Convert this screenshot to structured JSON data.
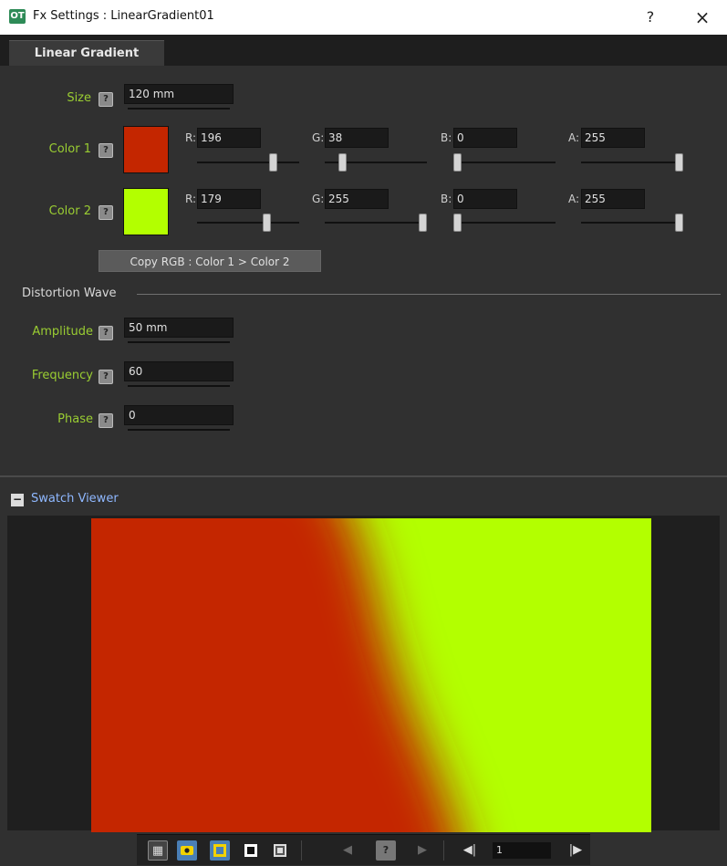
{
  "window": {
    "app_icon": "OT",
    "title": "Fx Settings : LinearGradient01",
    "help_label": "?",
    "close_label": "×"
  },
  "tabs": [
    {
      "label": "Linear Gradient",
      "active": true
    }
  ],
  "params": {
    "size": {
      "label": "Size",
      "value": "120 mm"
    },
    "color1": {
      "label": "Color 1",
      "hex": "#c42600",
      "r": {
        "label": "R:",
        "value": "196",
        "fraction": 0.769
      },
      "g": {
        "label": "G:",
        "value": "38",
        "fraction": 0.149
      },
      "b": {
        "label": "B:",
        "value": "0",
        "fraction": 0.0
      },
      "a": {
        "label": "A:",
        "value": "255",
        "fraction": 1.0
      }
    },
    "color2": {
      "label": "Color 2",
      "hex": "#b3ff00",
      "r": {
        "label": "R:",
        "value": "179",
        "fraction": 0.702
      },
      "g": {
        "label": "G:",
        "value": "255",
        "fraction": 1.0
      },
      "b": {
        "label": "B:",
        "value": "0",
        "fraction": 0.0
      },
      "a": {
        "label": "A:",
        "value": "255",
        "fraction": 1.0
      }
    },
    "copy_button": "Copy RGB : Color 1 > Color 2",
    "distortion_group": "Distortion Wave",
    "amplitude": {
      "label": "Amplitude",
      "value": "50 mm"
    },
    "frequency": {
      "label": "Frequency",
      "value": "60"
    },
    "phase": {
      "label": "Phase",
      "value": "0"
    },
    "key_icon": "?"
  },
  "swatch_viewer": {
    "collapse_label": "−",
    "title": "Swatch Viewer",
    "frame_value": "1",
    "toolbar_icons": [
      "checker-icon",
      "preview-eye-icon",
      "camera-stand-icon",
      "black-bg-icon",
      "white-bg-icon",
      "prev-key-icon",
      "key-icon",
      "next-key-icon",
      "prev-frame-icon",
      "next-frame-icon"
    ]
  },
  "colors": {
    "label_green": "#9acd32",
    "viewer_title": "#8fb8ff",
    "active_toggle": "#4a7fb5"
  }
}
